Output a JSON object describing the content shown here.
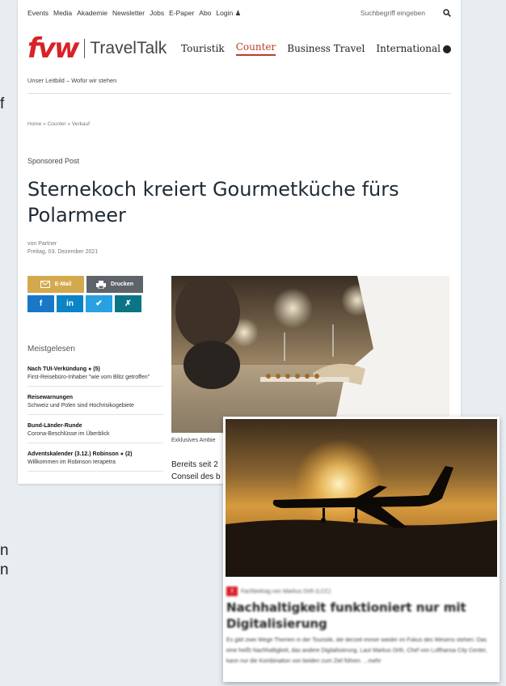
{
  "left_fragments": [
    "f",
    "n",
    "n"
  ],
  "topnav": {
    "links": [
      "Events",
      "Media",
      "Akademie",
      "Newsletter",
      "Jobs",
      "E-Paper",
      "Abo",
      "Login"
    ],
    "search_placeholder": "Suchbegriff eingeben"
  },
  "logo": {
    "brand": "fvw",
    "sub": "TravelTalk"
  },
  "mainnav": [
    "Touristik",
    "Counter",
    "Business Travel",
    "International"
  ],
  "mainnav_active": "Counter",
  "subnav": "Unser Leitbild – Wofür wir stehen",
  "breadcrumb": "Home » Counter » Verkauf",
  "article": {
    "kicker": "Sponsored Post",
    "headline": "Sternekoch kreiert Gourmetküche fürs Polarmeer",
    "author": "von Partner",
    "date": "Freitag, 03. Dezember 2021",
    "image_caption": "Exklusives Ambie",
    "lead_line1": "Bereits seit 2",
    "lead_line2": "Conseil des b"
  },
  "share": {
    "email": "E-Mail",
    "print": "Drucken",
    "fb": "f",
    "li": "in",
    "tw": "✔",
    "xi": "✗"
  },
  "meistgelesen": {
    "title": "Meistgelesen",
    "items": [
      {
        "head": "Nach TUI-Verkündung",
        "count": "(5)",
        "text": "First-Reisebüro-Inhaber \"wie vom Blitz getroffen\""
      },
      {
        "head": "Reisewarnungen",
        "count": "",
        "text": "Schweiz und Polen sind Hochrisikogebiete"
      },
      {
        "head": "Bund-Länder-Runde",
        "count": "",
        "text": "Corona-Beschlüsse im Überblick"
      },
      {
        "head": "Adventskalender (3.12.) Robinson",
        "count": "(2)",
        "text": "Willkommen im Robinson Ierapetra"
      }
    ]
  },
  "card": {
    "meta": "Fachbeitrag von Markus Orth (LCC)",
    "title": "Nachhaltigkeit funktioniert nur mit Digitalisierung",
    "text": "Es gibt zwei Wege Themen in der Touristik, die derzeit immer wieder im Fokus des Wesens stehen: Das eine heißt Nachhaltigkeit, das andere Digitalisierung. Laut Markus Orth, Chef von Lufthansa City Center, kann nur die Kombination von beiden zum Ziel führen. ...mehr"
  },
  "colors": {
    "brand_red": "#d92128",
    "email_btn": "#d4a94e",
    "print_btn": "#5e6469"
  }
}
